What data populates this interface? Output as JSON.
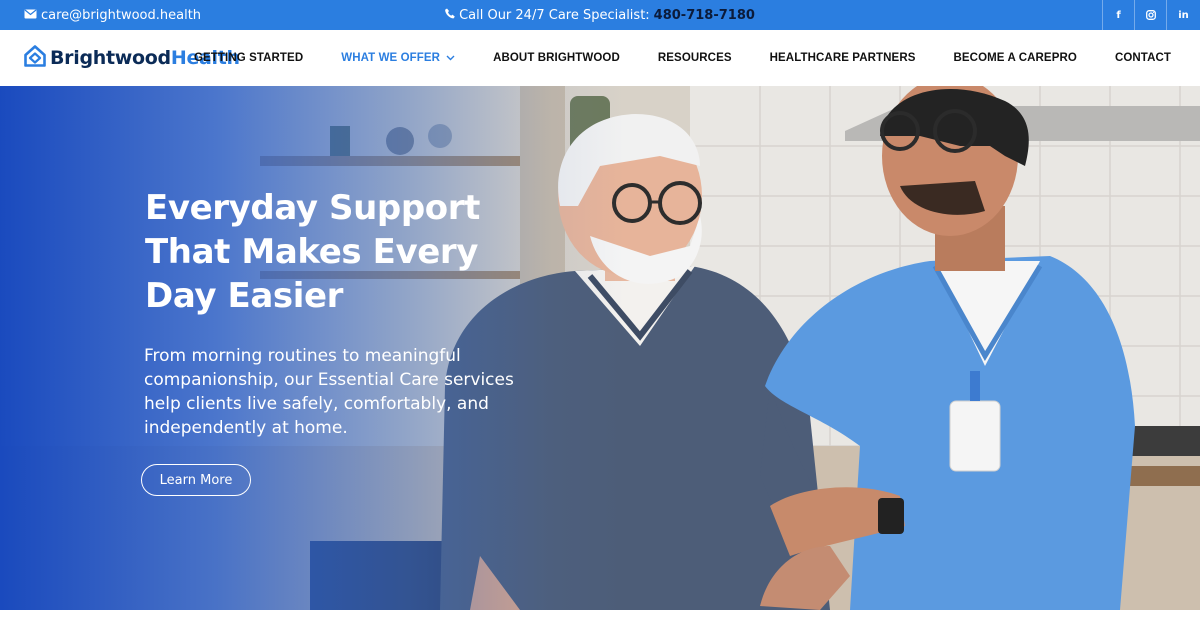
{
  "topbar": {
    "email": "care@brightwood.health",
    "phone_label": "Call Our 24/7 Care Specialist:",
    "phone_number": "480-718-7180",
    "social": [
      "f",
      "◎",
      "in"
    ]
  },
  "logo": {
    "part1": "Brightwood",
    "part2": "Health"
  },
  "nav": {
    "items": [
      "GETTING STARTED",
      "WHAT WE OFFER",
      "ABOUT BRIGHTWOOD",
      "RESOURCES",
      "HEALTHCARE PARTNERS",
      "BECOME A CAREPRO",
      "CONTACT"
    ],
    "active_index": 1
  },
  "hero": {
    "title_line1": "Everyday Support",
    "title_line2": "That Makes Every",
    "title_line3": "Day Easier",
    "subtitle_line1": "From morning routines to meaningful",
    "subtitle_line2": "companionship, our Essential Care services",
    "subtitle_line3": "help clients live safely, comfortably, and",
    "subtitle_line4": "independently at home.",
    "button_label": "Learn More"
  },
  "colors": {
    "brand_blue": "#2b7ee0",
    "navy": "#0b2b57"
  },
  "icons": [
    "email-icon",
    "phone-icon",
    "facebook-icon",
    "instagram-icon",
    "linkedin-icon",
    "logo-house-icon",
    "chevron-down-icon"
  ]
}
